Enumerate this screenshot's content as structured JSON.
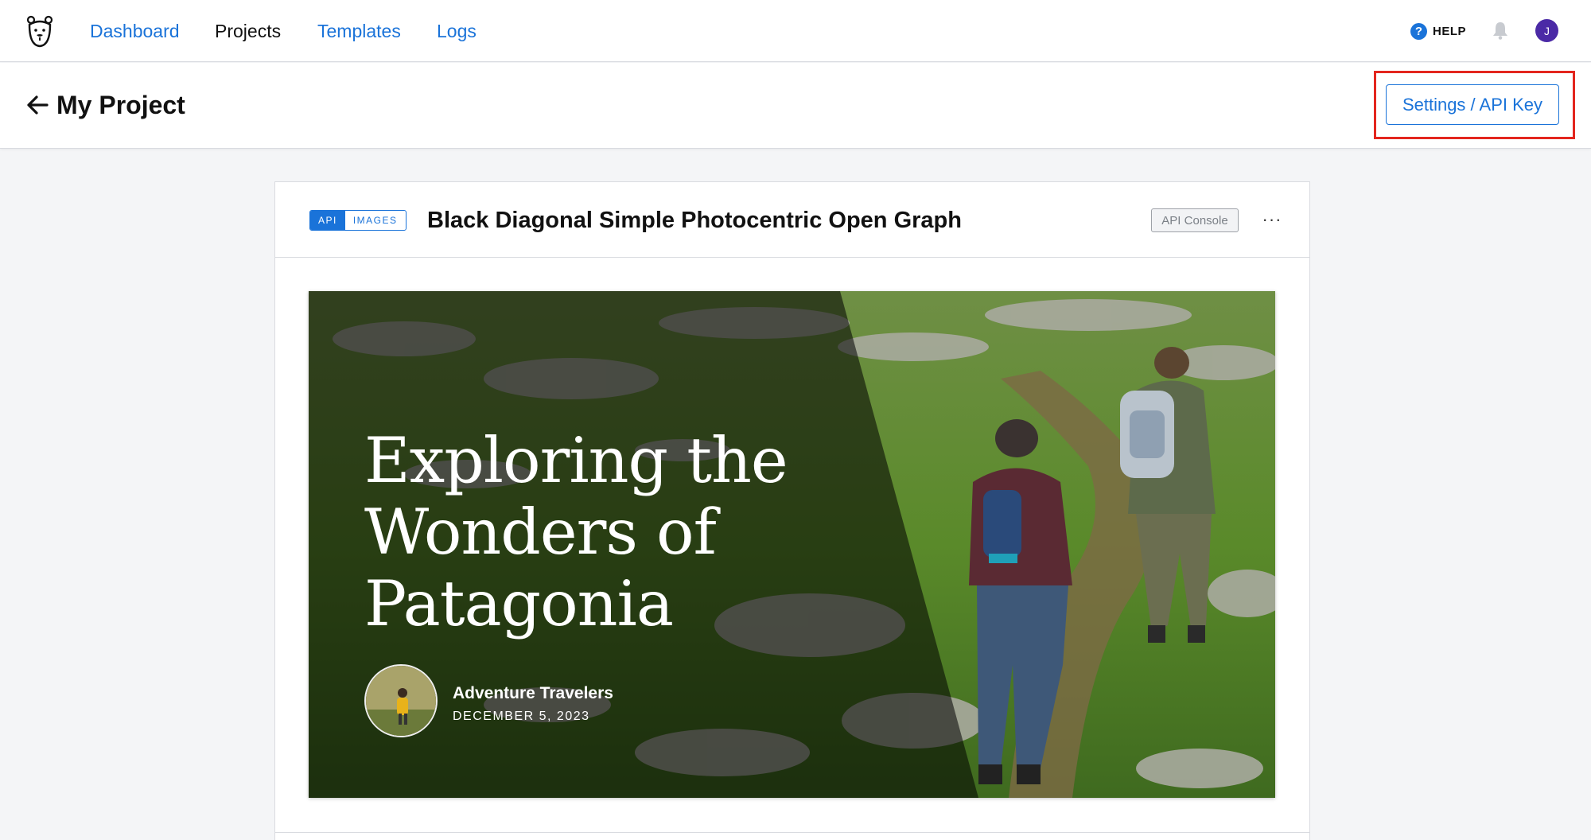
{
  "nav": {
    "links": [
      "Dashboard",
      "Projects",
      "Templates",
      "Logs"
    ],
    "help_label": "HELP",
    "avatar_initial": "J"
  },
  "project": {
    "title": "My Project",
    "settings_label": "Settings / API Key"
  },
  "template_card": {
    "badge_api": "API",
    "badge_images": "IMAGES",
    "title": "Black Diagonal Simple Photocentric Open Graph",
    "console_label": "API Console",
    "more_label": "···"
  },
  "preview": {
    "headline": "Exploring the Wonders of Patagonia",
    "author": "Adventure Travelers",
    "date": "DECEMBER 5, 2023"
  },
  "colors": {
    "accent": "#1a73d9",
    "highlight": "#e3261e",
    "avatar": "#4b2aa6"
  }
}
